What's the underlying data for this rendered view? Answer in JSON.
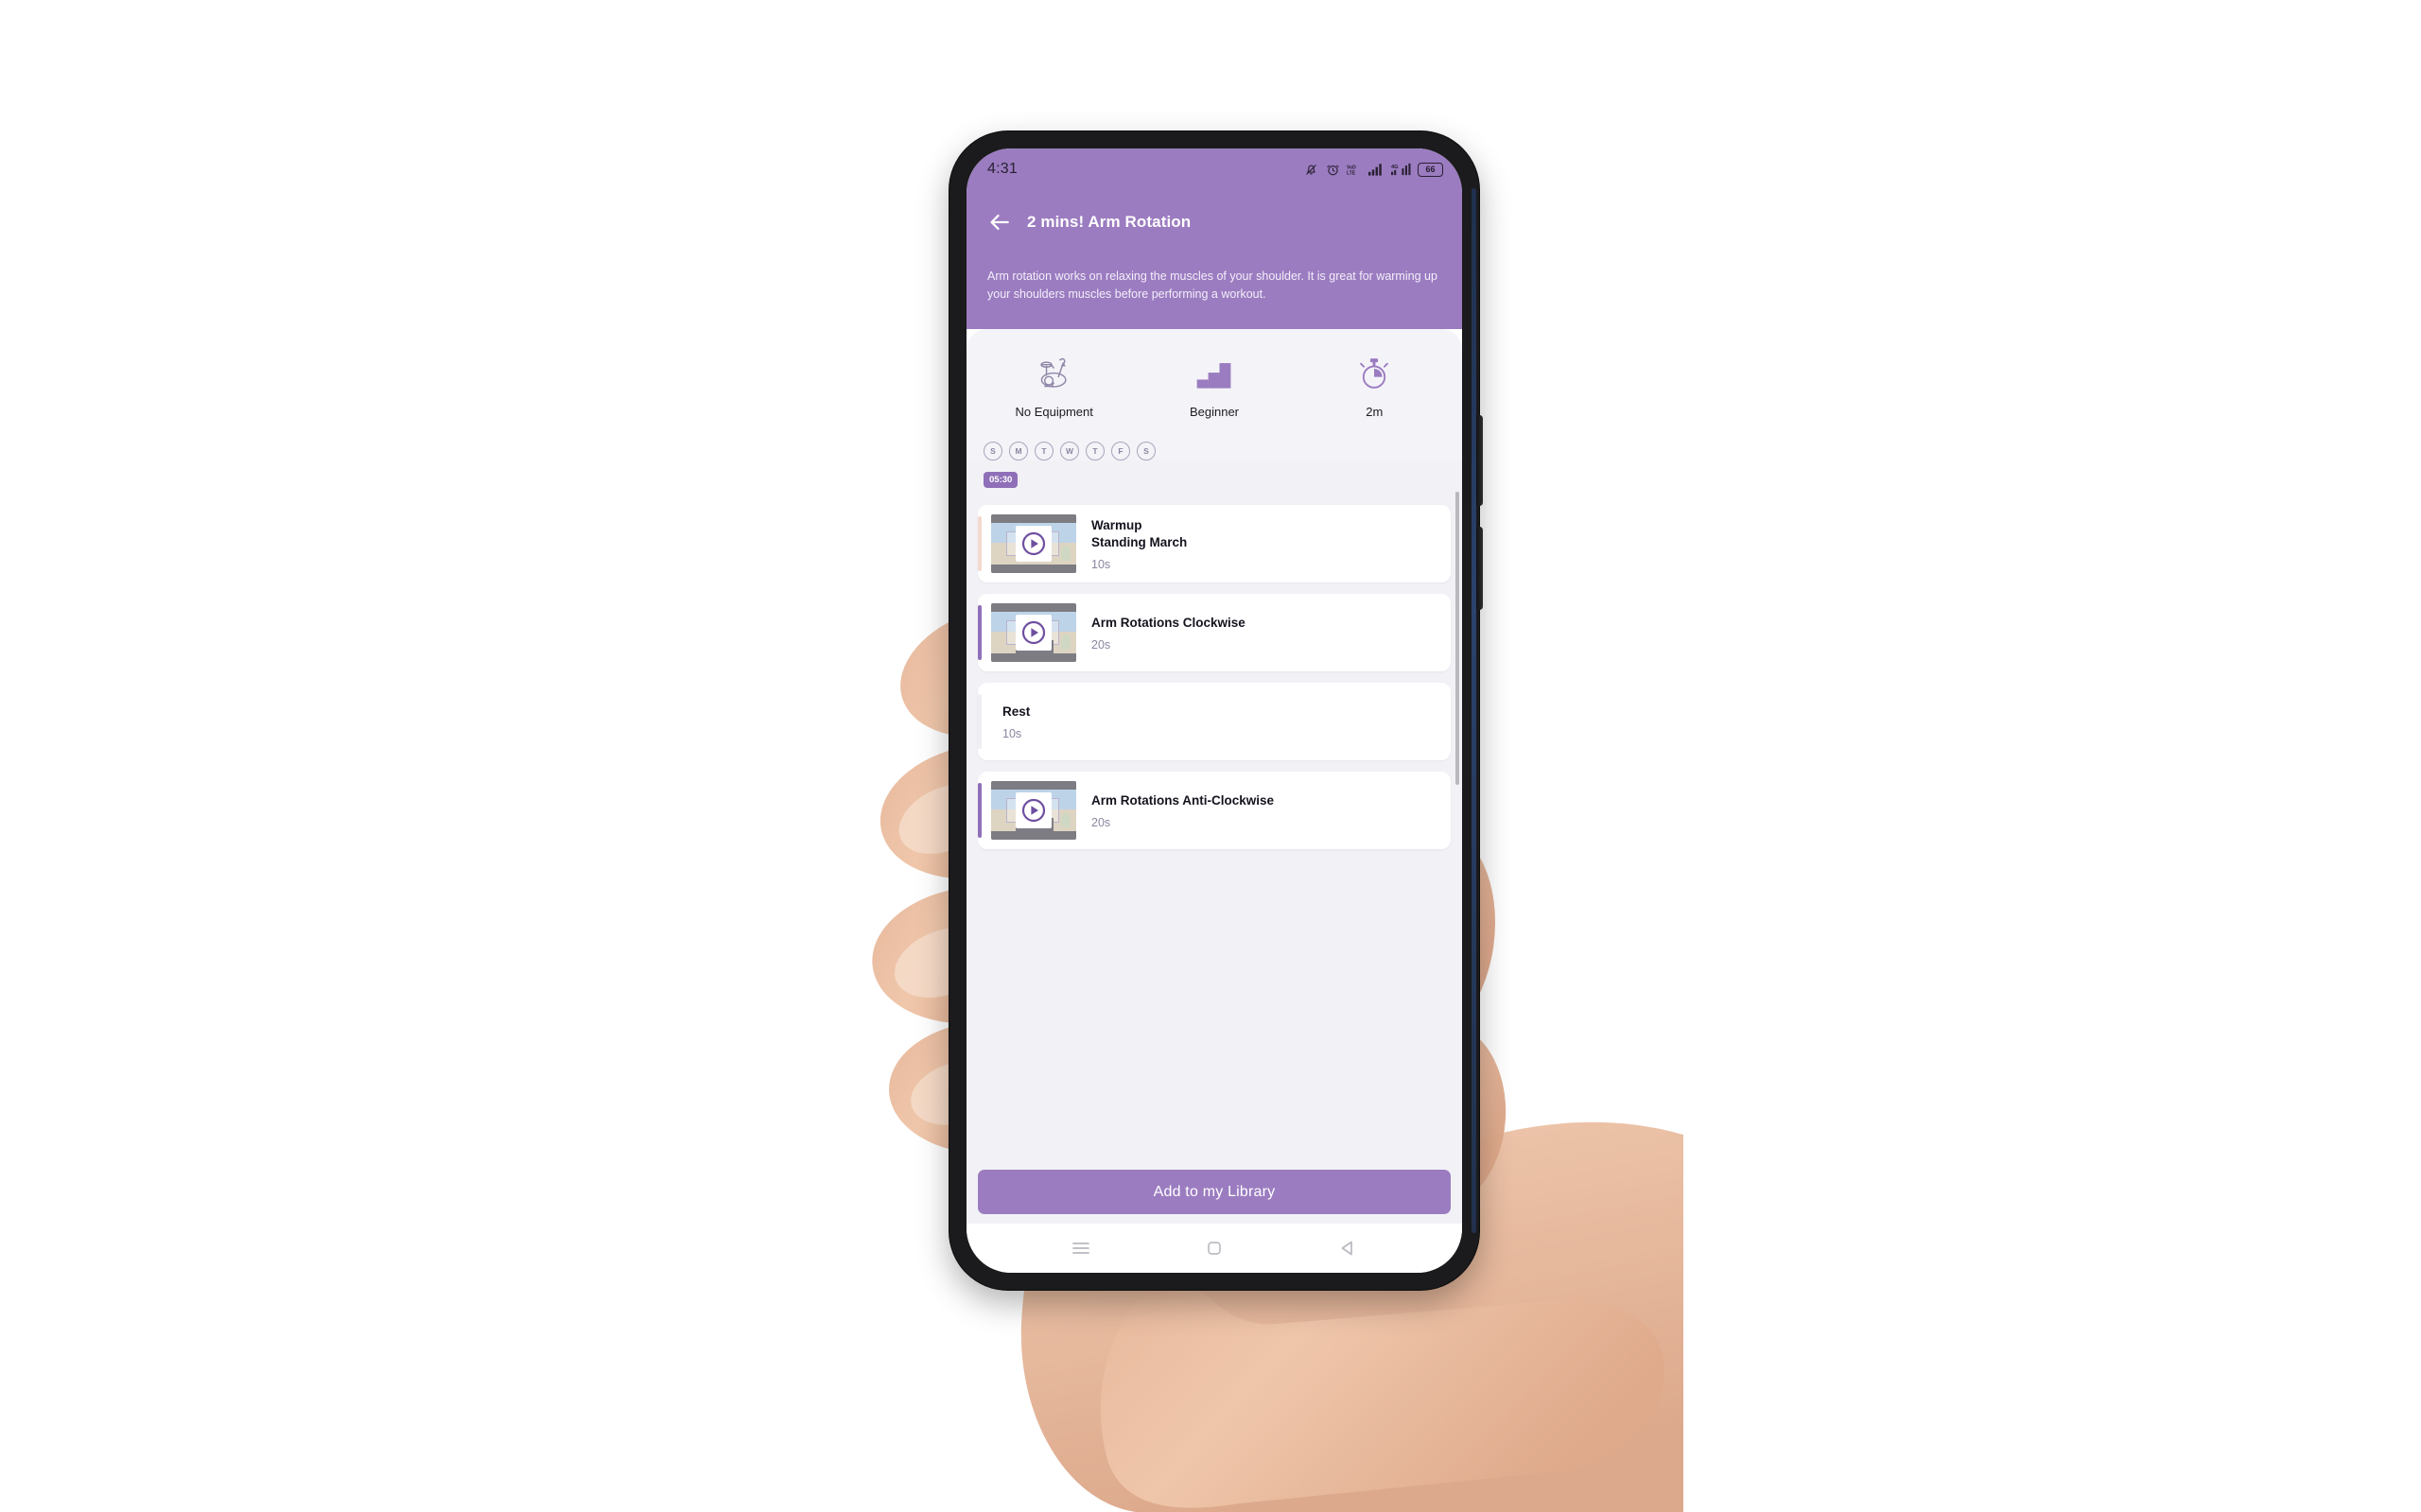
{
  "statusbar": {
    "time": "4:31",
    "battery_level": "66",
    "icons": [
      "bell-silent-icon",
      "alarm-clock-icon",
      "volte-icon",
      "signal-bars-icon",
      "signal-4g-icon",
      "battery-icon"
    ]
  },
  "header": {
    "back_label": "back-arrow-icon",
    "title": "2 mins! Arm Rotation",
    "description": "Arm rotation works on relaxing the muscles of your shoulder. It is great for warming up your shoulders muscles before performing a workout."
  },
  "meta": [
    {
      "icon": "exercise-bike-icon",
      "label": "No Equipment"
    },
    {
      "icon": "stairs-level-icon",
      "label": "Beginner"
    },
    {
      "icon": "stopwatch-icon",
      "label": "2m"
    }
  ],
  "schedule": {
    "days": [
      "S",
      "M",
      "T",
      "W",
      "T",
      "F",
      "S"
    ],
    "time_chip": "05:30"
  },
  "exercises": [
    {
      "kind": "warmup",
      "label": "Warmup",
      "title": "Standing March",
      "duration": "10s",
      "has_video": true,
      "accent": "#f3d9cd"
    },
    {
      "kind": "exercise",
      "label": "",
      "title": "Arm Rotations Clockwise",
      "duration": "20s",
      "has_video": true,
      "accent": "#8f6fb8"
    },
    {
      "kind": "rest",
      "label": "",
      "title": "Rest",
      "duration": "10s",
      "has_video": false,
      "accent": "#efeef3"
    },
    {
      "kind": "exercise",
      "label": "",
      "title": "Arm Rotations Anti-Clockwise",
      "duration": "20s",
      "has_video": true,
      "accent": "#8f6fb8"
    }
  ],
  "cta": {
    "label": "Add to my Library"
  },
  "navbar": {
    "items": [
      "menu-icon",
      "home-square-icon",
      "back-triangle-icon"
    ]
  },
  "colors": {
    "brand_purple": "#9b7cc0",
    "accent_purple": "#8f6fb8",
    "sheet_bg": "#f2f1f6",
    "card_bg": "#ffffff",
    "text_dark": "#16131f",
    "text_muted": "#8b86a0"
  }
}
